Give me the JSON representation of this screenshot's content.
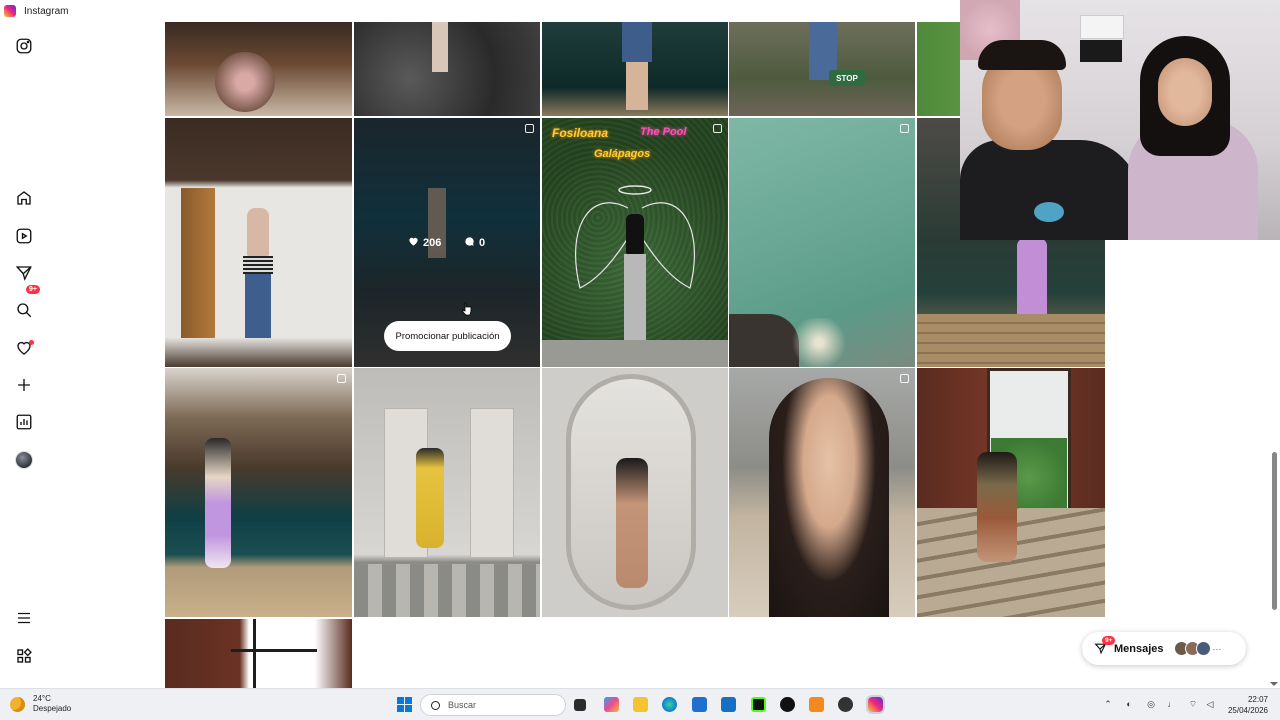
{
  "window": {
    "title": "Instagram"
  },
  "sidebar": {
    "items": [
      {
        "name": "instagram-logo-icon"
      },
      {
        "name": "home-icon"
      },
      {
        "name": "reels-icon"
      },
      {
        "name": "messages-icon",
        "badge": "9+"
      },
      {
        "name": "search-icon"
      },
      {
        "name": "notifications-heart-icon"
      },
      {
        "name": "create-plus-icon"
      },
      {
        "name": "insights-icon"
      },
      {
        "name": "profile-avatar"
      },
      {
        "name": "menu-icon"
      },
      {
        "name": "apps-icon"
      }
    ]
  },
  "grid": {
    "hover_post": {
      "likes": "206",
      "comments": "0",
      "promote_label": "Promocionar publicación"
    },
    "neon_sign": {
      "line1": "Fosiloana",
      "line2": "The Pool",
      "line3": "Galápagos"
    },
    "stop_sign": "STOP"
  },
  "messages_pill": {
    "label": "Mensajes",
    "badge": "9+",
    "more": "···"
  },
  "taskbar": {
    "weather": {
      "temp": "24°C",
      "condition": "Despejado"
    },
    "search_placeholder": "Buscar",
    "time": "22:07",
    "date": "25/04/2026"
  },
  "colors": {
    "accent_red": "#ff3040",
    "windows_blue": "#0a78d7",
    "instagram_gradient": [
      "#f9ce34",
      "#ee2a7b",
      "#6228d7"
    ]
  }
}
